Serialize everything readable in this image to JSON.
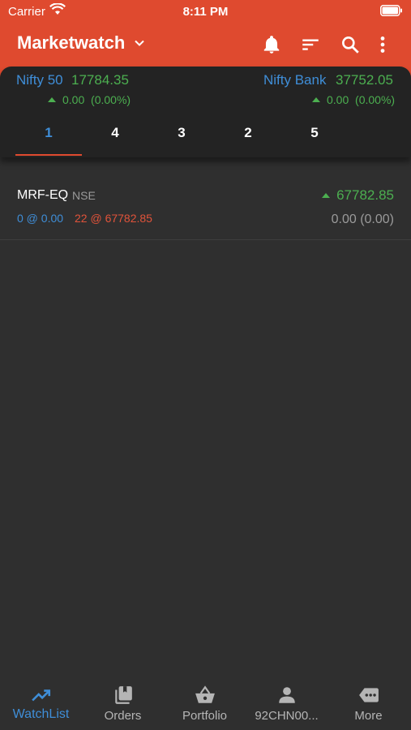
{
  "status_bar": {
    "carrier": "Carrier",
    "time": "8:11 PM"
  },
  "header": {
    "title": "Marketwatch",
    "icons": [
      "chevron-down-icon",
      "bell-icon",
      "sort-icon",
      "search-icon",
      "more-vert-icon"
    ]
  },
  "indices": [
    {
      "name": "Nifty 50",
      "value": "17784.35",
      "change": "0.00",
      "change_pct": "(0.00%)"
    },
    {
      "name": "Nifty Bank",
      "value": "37752.05",
      "change": "0.00",
      "change_pct": "(0.00%)"
    }
  ],
  "tabs": [
    {
      "label": "1",
      "active": true
    },
    {
      "label": "4"
    },
    {
      "label": "3"
    },
    {
      "label": "2"
    },
    {
      "label": "5"
    }
  ],
  "watchlist": [
    {
      "symbol": "MRF-EQ",
      "exchange": "NSE",
      "bid": "0 @ 0.00",
      "ask": "22 @ 67782.85",
      "ltp": "67782.85",
      "change": "0.00 (0.00)"
    }
  ],
  "bottom_nav": [
    {
      "label": "WatchList",
      "icon": "trending-up-icon",
      "active": true
    },
    {
      "label": "Orders",
      "icon": "orders-icon"
    },
    {
      "label": "Portfolio",
      "icon": "basket-icon"
    },
    {
      "label": "92CHN00...",
      "icon": "person-icon"
    },
    {
      "label": "More",
      "icon": "more-chat-icon"
    }
  ],
  "colors": {
    "header": "#df4a2f",
    "accent_blue": "#3f8ed8",
    "up_green": "#4caf50",
    "ask_red": "#e0533a",
    "background": "#2f2f2f"
  }
}
